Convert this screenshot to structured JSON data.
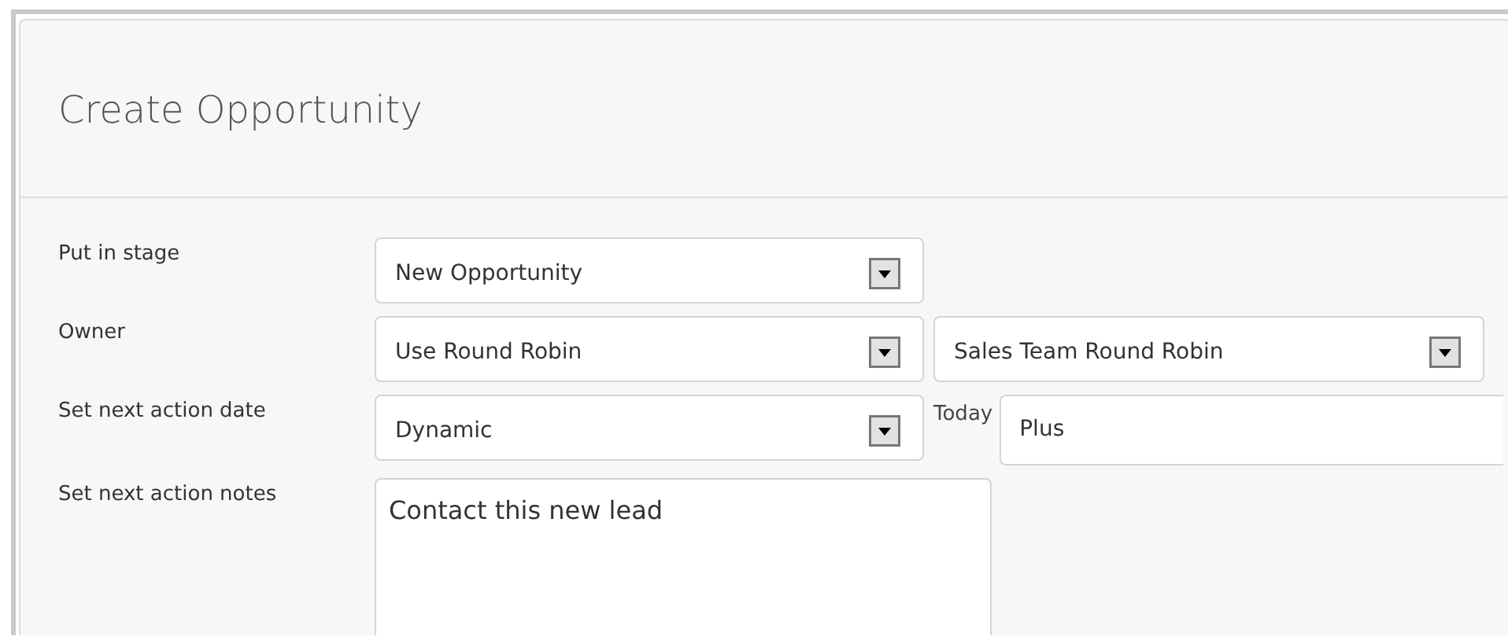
{
  "dialog": {
    "title": "Create Opportunity"
  },
  "rows": [
    {
      "label": "Put in stage",
      "controls": [
        {
          "kind": "select",
          "value": "New Opportunity"
        }
      ]
    },
    {
      "label": "Owner",
      "controls": [
        {
          "kind": "select",
          "value": "Use Round Robin"
        },
        {
          "kind": "select",
          "value": "Sales Team Round Robin"
        }
      ]
    },
    {
      "label": "Set next action date",
      "controls": [
        {
          "kind": "select",
          "value": "Dynamic"
        },
        {
          "kind": "caption",
          "text": "Today"
        },
        {
          "kind": "text",
          "value": "Plus"
        }
      ]
    },
    {
      "label": "Set next action notes",
      "controls": [
        {
          "kind": "textarea",
          "value": "Contact this new lead"
        }
      ]
    }
  ]
}
